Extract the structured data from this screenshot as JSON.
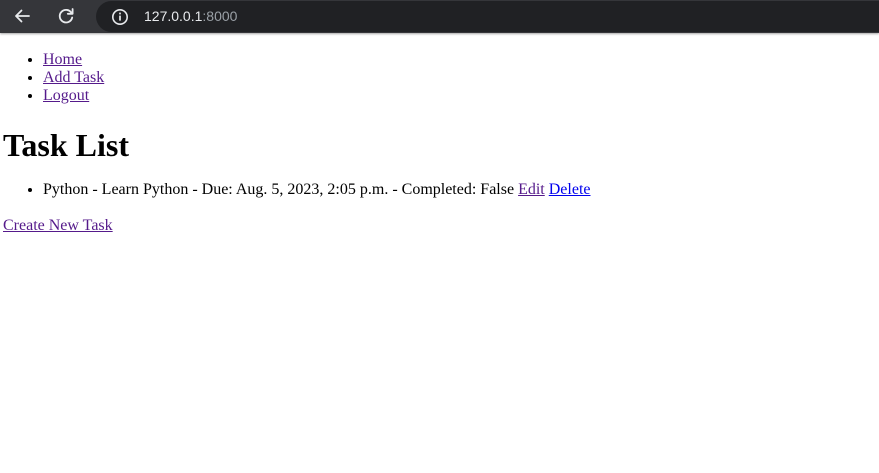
{
  "browser": {
    "url_host": "127.0.0.1",
    "url_port": ":8000",
    "icons": {
      "back": "back-arrow-icon",
      "reload": "reload-icon",
      "info": "info-icon"
    },
    "colors": {
      "toolbar": "#35363a",
      "omnibox": "#202124"
    }
  },
  "nav": {
    "items": [
      {
        "label": "Home"
      },
      {
        "label": "Add Task"
      },
      {
        "label": "Logout"
      }
    ]
  },
  "main": {
    "title": "Task List",
    "tasks": [
      {
        "text": "Python - Learn Python - Due: Aug. 5, 2023, 2:05 p.m. - Completed: False",
        "edit_label": "Edit",
        "delete_label": "Delete"
      }
    ],
    "create_label": "Create New Task"
  },
  "colors": {
    "link": "#0000ee",
    "visited_link": "#551a8b"
  }
}
